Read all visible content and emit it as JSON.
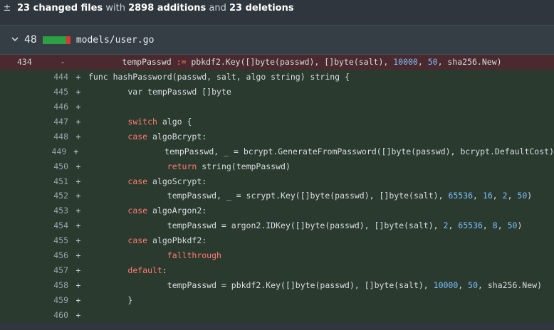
{
  "summary": {
    "icon": "plus-minus-icon",
    "prefix": "23 changed files",
    "with": " with ",
    "additions": "2898 additions",
    "and": " and ",
    "deletions": "23 deletions"
  },
  "file": {
    "expand_icon": "chevron-down-icon",
    "change_count": "48",
    "path": "models/user.go"
  },
  "colors": {
    "addition": "#2ea043",
    "deletion": "#da3633",
    "keyword": "#ff7b72",
    "number": "#79c0ff"
  },
  "lines": [
    {
      "type": "del",
      "old": "434",
      "new": "",
      "sign": "-",
      "tokens": [
        {
          "t": "        tempPasswd ",
          "c": "code"
        },
        {
          "t": ":=",
          "c": "kw"
        },
        {
          "t": " pbkdf2.Key([]byte(passwd), []byte(salt), ",
          "c": "code"
        },
        {
          "t": "10000",
          "c": "num"
        },
        {
          "t": ", ",
          "c": "code"
        },
        {
          "t": "50",
          "c": "num"
        },
        {
          "t": ", sha256.New)",
          "c": "code"
        }
      ]
    },
    {
      "type": "add",
      "old": "",
      "new": "444",
      "sign": "+",
      "tokens": [
        {
          "t": "func hashPassword(passwd, salt, algo string) string {",
          "c": "code"
        }
      ]
    },
    {
      "type": "add",
      "old": "",
      "new": "445",
      "sign": "+",
      "tokens": [
        {
          "t": "        var tempPasswd []byte",
          "c": "code"
        }
      ]
    },
    {
      "type": "add",
      "old": "",
      "new": "446",
      "sign": "+",
      "tokens": []
    },
    {
      "type": "add",
      "old": "",
      "new": "447",
      "sign": "+",
      "tokens": [
        {
          "t": "        ",
          "c": "code"
        },
        {
          "t": "switch",
          "c": "kw"
        },
        {
          "t": " algo {",
          "c": "code"
        }
      ]
    },
    {
      "type": "add",
      "old": "",
      "new": "448",
      "sign": "+",
      "tokens": [
        {
          "t": "        ",
          "c": "code"
        },
        {
          "t": "case",
          "c": "kw"
        },
        {
          "t": " algoBcrypt:",
          "c": "code"
        }
      ]
    },
    {
      "type": "add",
      "old": "",
      "new": "449",
      "sign": "+",
      "tokens": [
        {
          "t": "                tempPasswd, _ = bcrypt.GenerateFromPassword([]byte(passwd), bcrypt.DefaultCost)",
          "c": "code"
        }
      ]
    },
    {
      "type": "add",
      "old": "",
      "new": "450",
      "sign": "+",
      "tokens": [
        {
          "t": "                ",
          "c": "code"
        },
        {
          "t": "return",
          "c": "kw"
        },
        {
          "t": " string(tempPasswd)",
          "c": "code"
        }
      ]
    },
    {
      "type": "add",
      "old": "",
      "new": "451",
      "sign": "+",
      "tokens": [
        {
          "t": "        ",
          "c": "code"
        },
        {
          "t": "case",
          "c": "kw"
        },
        {
          "t": " algoScrypt:",
          "c": "code"
        }
      ]
    },
    {
      "type": "add",
      "old": "",
      "new": "452",
      "sign": "+",
      "tokens": [
        {
          "t": "                tempPasswd, _ = scrypt.Key([]byte(passwd), []byte(salt), ",
          "c": "code"
        },
        {
          "t": "65536",
          "c": "num"
        },
        {
          "t": ", ",
          "c": "code"
        },
        {
          "t": "16",
          "c": "num"
        },
        {
          "t": ", ",
          "c": "code"
        },
        {
          "t": "2",
          "c": "num"
        },
        {
          "t": ", ",
          "c": "code"
        },
        {
          "t": "50",
          "c": "num"
        },
        {
          "t": ")",
          "c": "code"
        }
      ]
    },
    {
      "type": "add",
      "old": "",
      "new": "453",
      "sign": "+",
      "tokens": [
        {
          "t": "        ",
          "c": "code"
        },
        {
          "t": "case",
          "c": "kw"
        },
        {
          "t": " algoArgon2:",
          "c": "code"
        }
      ]
    },
    {
      "type": "add",
      "old": "",
      "new": "454",
      "sign": "+",
      "tokens": [
        {
          "t": "                tempPasswd = argon2.IDKey([]byte(passwd), []byte(salt), ",
          "c": "code"
        },
        {
          "t": "2",
          "c": "num"
        },
        {
          "t": ", ",
          "c": "code"
        },
        {
          "t": "65536",
          "c": "num"
        },
        {
          "t": ", ",
          "c": "code"
        },
        {
          "t": "8",
          "c": "num"
        },
        {
          "t": ", ",
          "c": "code"
        },
        {
          "t": "50",
          "c": "num"
        },
        {
          "t": ")",
          "c": "code"
        }
      ]
    },
    {
      "type": "add",
      "old": "",
      "new": "455",
      "sign": "+",
      "tokens": [
        {
          "t": "        ",
          "c": "code"
        },
        {
          "t": "case",
          "c": "kw"
        },
        {
          "t": " algoPbkdf2:",
          "c": "code"
        }
      ]
    },
    {
      "type": "add",
      "old": "",
      "new": "456",
      "sign": "+",
      "tokens": [
        {
          "t": "                ",
          "c": "code"
        },
        {
          "t": "fallthrough",
          "c": "kw"
        }
      ]
    },
    {
      "type": "add",
      "old": "",
      "new": "457",
      "sign": "+",
      "tokens": [
        {
          "t": "        ",
          "c": "code"
        },
        {
          "t": "default",
          "c": "kw"
        },
        {
          "t": ":",
          "c": "code"
        }
      ]
    },
    {
      "type": "add",
      "old": "",
      "new": "458",
      "sign": "+",
      "tokens": [
        {
          "t": "                tempPasswd = pbkdf2.Key([]byte(passwd), []byte(salt), ",
          "c": "code"
        },
        {
          "t": "10000",
          "c": "num"
        },
        {
          "t": ", ",
          "c": "code"
        },
        {
          "t": "50",
          "c": "num"
        },
        {
          "t": ", sha256.New)",
          "c": "code"
        }
      ]
    },
    {
      "type": "add",
      "old": "",
      "new": "459",
      "sign": "+",
      "tokens": [
        {
          "t": "        }",
          "c": "code"
        }
      ]
    },
    {
      "type": "add",
      "old": "",
      "new": "460",
      "sign": "+",
      "tokens": []
    }
  ]
}
